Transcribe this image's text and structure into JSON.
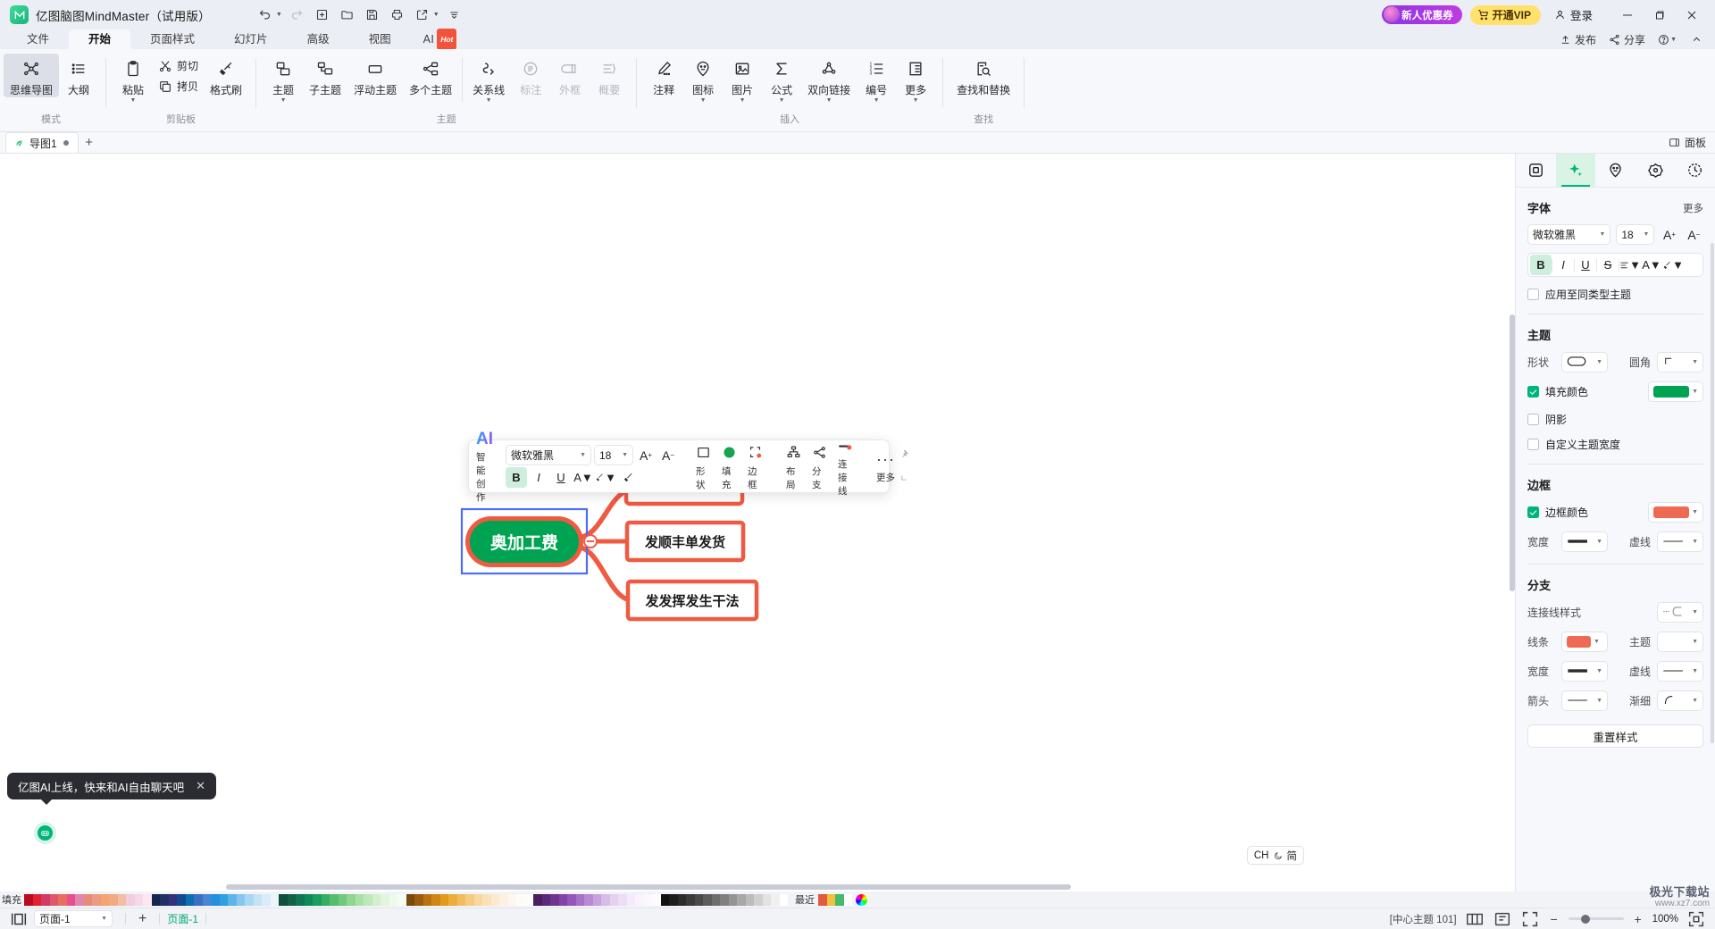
{
  "titlebar": {
    "app_title": "亿图脑图MindMaster（试用版）",
    "logo_icon": "mindmaster-logo-icon",
    "tools": [
      {
        "name": "undo-button",
        "icon": "undo-icon",
        "caret": true
      },
      {
        "name": "redo-button",
        "icon": "redo-icon",
        "caret": false
      },
      {
        "name": "new-button",
        "icon": "plus-square-icon",
        "caret": false
      },
      {
        "name": "open-button",
        "icon": "folder-icon",
        "caret": false
      },
      {
        "name": "save-button",
        "icon": "save-icon",
        "caret": false
      },
      {
        "name": "print-button",
        "icon": "printer-icon",
        "caret": false
      },
      {
        "name": "share-export-button",
        "icon": "share-box-icon",
        "caret": true
      },
      {
        "name": "more-toolbar-button",
        "icon": "more-bars-icon",
        "caret": false
      }
    ],
    "coupon_label": "新人优惠券",
    "vip_label": "开通VIP",
    "login_label": "登录",
    "window_buttons": [
      "minimize",
      "maximize",
      "close"
    ]
  },
  "ribbon_tabs": {
    "items": [
      {
        "label": "文件",
        "name": "tab-file",
        "active": false
      },
      {
        "label": "开始",
        "name": "tab-home",
        "active": true
      },
      {
        "label": "页面样式",
        "name": "tab-page-style",
        "active": false
      },
      {
        "label": "幻灯片",
        "name": "tab-slides",
        "active": false
      },
      {
        "label": "高级",
        "name": "tab-advanced",
        "active": false
      },
      {
        "label": "视图",
        "name": "tab-view",
        "active": false
      }
    ],
    "ai_label": "AI",
    "ai_badge": "Hot",
    "right_items": [
      {
        "label": "发布",
        "name": "publish-button",
        "icon": "upload-icon"
      },
      {
        "label": "分享",
        "name": "share-button",
        "icon": "share-icon"
      },
      {
        "label": "",
        "name": "help-button",
        "icon": "question-icon"
      },
      {
        "label": "",
        "name": "collapse-ribbon-button",
        "icon": "chevron-up-icon"
      }
    ]
  },
  "ribbon": {
    "groups": [
      {
        "label": "模式",
        "name": "group-mode",
        "items": [
          {
            "label": "思维导图",
            "name": "mindmap-mode-button",
            "icon": "mindmap-icon",
            "selected": true,
            "dropdown": false,
            "disabled": false
          },
          {
            "label": "大纲",
            "name": "outline-mode-button",
            "icon": "outline-icon",
            "selected": false,
            "dropdown": false,
            "disabled": false
          }
        ]
      },
      {
        "label": "剪贴板",
        "name": "group-clipboard",
        "items": [
          {
            "label": "粘贴",
            "name": "paste-button",
            "icon": "clipboard-icon",
            "selected": false,
            "dropdown": true,
            "disabled": false
          },
          {
            "label": "剪切",
            "name": "cut-button",
            "icon": "scissors-icon",
            "horizontal": true
          },
          {
            "label": "拷贝",
            "name": "copy-button",
            "icon": "copy-icon",
            "horizontal": true
          },
          {
            "label": "格式刷",
            "name": "format-painter-button",
            "icon": "brush-icon",
            "selected": false,
            "dropdown": false,
            "disabled": false
          }
        ]
      },
      {
        "label": "主题",
        "name": "group-topic",
        "items": [
          {
            "label": "主题",
            "name": "topic-button",
            "icon": "topic-icon",
            "selected": false,
            "dropdown": true,
            "disabled": false
          },
          {
            "label": "子主题",
            "name": "subtopic-button",
            "icon": "subtopic-icon",
            "selected": false,
            "dropdown": false,
            "disabled": false
          },
          {
            "label": "浮动主题",
            "name": "floating-topic-button",
            "icon": "floating-topic-icon",
            "selected": false,
            "dropdown": false,
            "disabled": false
          },
          {
            "label": "多个主题",
            "name": "multi-topic-button",
            "icon": "multi-topic-icon",
            "selected": false,
            "dropdown": false,
            "disabled": false
          },
          {
            "label": "关系线",
            "name": "relationship-line-button",
            "icon": "relationship-icon",
            "selected": false,
            "dropdown": true,
            "disabled": false
          },
          {
            "label": "标注",
            "name": "callout-button",
            "icon": "callout-icon",
            "selected": false,
            "dropdown": false,
            "disabled": true
          },
          {
            "label": "外框",
            "name": "boundary-button",
            "icon": "boundary-icon",
            "selected": false,
            "dropdown": false,
            "disabled": true
          },
          {
            "label": "概要",
            "name": "summary-button",
            "icon": "summary-icon",
            "selected": false,
            "dropdown": false,
            "disabled": true
          }
        ]
      },
      {
        "label": "插入",
        "name": "group-insert",
        "items": [
          {
            "label": "注释",
            "name": "comment-button",
            "icon": "pencil-note-icon",
            "selected": false,
            "dropdown": false,
            "disabled": false
          },
          {
            "label": "图标",
            "name": "icon-button",
            "icon": "emoji-pin-icon",
            "selected": false,
            "dropdown": true,
            "disabled": false
          },
          {
            "label": "图片",
            "name": "image-button",
            "icon": "image-icon",
            "selected": false,
            "dropdown": true,
            "disabled": false
          },
          {
            "label": "公式",
            "name": "formula-button",
            "icon": "sigma-icon",
            "selected": false,
            "dropdown": true,
            "disabled": false
          },
          {
            "label": "双向链接",
            "name": "bidirectional-link-button",
            "icon": "link-node-icon",
            "selected": false,
            "dropdown": true,
            "disabled": false
          },
          {
            "label": "编号",
            "name": "numbering-button",
            "icon": "numbered-list-icon",
            "selected": false,
            "dropdown": true,
            "disabled": false
          },
          {
            "label": "更多",
            "name": "insert-more-button",
            "icon": "more-panel-icon",
            "selected": false,
            "dropdown": true,
            "disabled": false
          }
        ]
      },
      {
        "label": "查找",
        "name": "group-find",
        "items": [
          {
            "label": "查找和替换",
            "name": "find-replace-button",
            "icon": "find-replace-icon",
            "selected": false,
            "dropdown": false,
            "disabled": false
          }
        ]
      }
    ]
  },
  "doctabs": {
    "tabs": [
      {
        "label": "导图1",
        "name": "document-tab-1",
        "modified": true
      }
    ],
    "add_label": "+",
    "panel_toggle_label": "面板",
    "panel_toggle_icon": "panel-icon"
  },
  "floating_toolbar": {
    "ai_title": "AI",
    "ai_sub": "智能创作",
    "font_family": "微软雅黑",
    "font_size": "18",
    "increase_font_icon": "increase-font-icon",
    "decrease_font_icon": "decrease-font-icon",
    "bold": "B",
    "italic": "I",
    "underline": "U",
    "font_color_icon": "font-color-icon",
    "highlight_icon": "highlight-icon",
    "format_painter_icon": "format-painter-icon",
    "groups": [
      {
        "label": "形状",
        "name": "shape-button",
        "icon": "square-shape-icon"
      },
      {
        "label": "填充",
        "name": "fill-button",
        "icon": "fill-circle-icon",
        "color": "#14a44d"
      },
      {
        "label": "边框",
        "name": "border-button",
        "icon": "border-icon",
        "color": "#ef5a41"
      },
      {
        "label": "布局",
        "name": "layout-button",
        "icon": "layout-icon"
      },
      {
        "label": "分支",
        "name": "branch-button",
        "icon": "branch-icon"
      },
      {
        "label": "连接线",
        "name": "connector-button",
        "icon": "connector-icon",
        "color": "#ef5a41"
      },
      {
        "label": "更多",
        "name": "more-button",
        "icon": "ellipsis-icon"
      }
    ],
    "pin_icon": "pin-icon",
    "resize_icon": "resize-handle-icon"
  },
  "mindmap": {
    "central_topic": {
      "text": "奥加工费",
      "name": "central-topic-node",
      "fill": "#00a352",
      "border": "#ef5a41",
      "selection": "#4a6cf7"
    },
    "branches": [
      {
        "text": "发顺丰单发货",
        "name": "topic-node-2"
      },
      {
        "text": "发发挥发生干法",
        "name": "topic-node-3"
      }
    ],
    "collapse_icon": "collapse-minus-icon",
    "node_border_color": "#ef5a41"
  },
  "right_panel": {
    "tabs": [
      {
        "name": "panel-tab-style",
        "icon": "style-square-icon",
        "active": false
      },
      {
        "name": "panel-tab-ai",
        "icon": "ai-sparkle-icon",
        "active": true
      },
      {
        "name": "panel-tab-icon",
        "icon": "emoji-pin-icon",
        "active": false
      },
      {
        "name": "panel-tab-sticker",
        "icon": "sticker-flower-icon",
        "active": false
      },
      {
        "name": "panel-tab-history",
        "icon": "history-clock-icon",
        "active": false
      }
    ],
    "font_section": {
      "title": "字体",
      "more": "更多",
      "family": "微软雅黑",
      "size": "18",
      "increase_icon": "increase-font-icon",
      "decrease_icon": "decrease-font-icon",
      "bold": "B",
      "italic": "I",
      "underline": "U",
      "strikethrough": "S",
      "align_icon": "align-icon",
      "font_color_icon": "font-color-icon",
      "highlight_icon": "highlight-icon",
      "apply_same_label": "应用至同类型主题",
      "apply_same_checked": false
    },
    "topic_section": {
      "title": "主题",
      "shape_label": "形状",
      "shape_value_icon": "rounded-rect-icon",
      "corner_label": "圆角",
      "corner_value_icon": "corner-icon",
      "fill_label": "填充颜色",
      "fill_checked": true,
      "fill_color": "#00a352",
      "shadow_label": "阴影",
      "shadow_checked": false,
      "custom_width_label": "自定义主题宽度",
      "custom_width_checked": false
    },
    "border_section": {
      "title": "边框",
      "color_label": "边框颜色",
      "color_checked": true,
      "color": "#ef6a52",
      "width_label": "宽度",
      "dash_label": "虚线"
    },
    "branch_section": {
      "title": "分支",
      "style_label": "连接线样式",
      "line_label": "线条",
      "line_color": "#ef6a52",
      "topic_label": "主题",
      "width_label": "宽度",
      "dash_label": "虚线",
      "arrow_label": "箭头",
      "taper_label": "渐细"
    },
    "reset_label": "重置样式"
  },
  "ai_tip": {
    "text": "亿图AI上线，快来和AI自由聊天吧",
    "close_icon": "close-icon",
    "bot_icon": "robot-icon"
  },
  "lang_pill": {
    "label": "CH",
    "mode": "简",
    "moon_icon": "moon-icon"
  },
  "color_strip": {
    "fill_label": "填充",
    "recent_label": "最近",
    "colors": [
      "#b60d1f",
      "#e02230",
      "#cf3a68",
      "#e0566a",
      "#e5705f",
      "#e84f8d",
      "#e087ad",
      "#e88a7a",
      "#ec9a84",
      "#f3a46f",
      "#eeab84",
      "#f3bfa3",
      "#f0cde0",
      "#f7d8e8",
      "#fbe9f2",
      "#16254f",
      "#1d3164",
      "#35307a",
      "#12498f",
      "#0c6fb0",
      "#3b6fc4",
      "#4b86d1",
      "#2490dc",
      "#2ea0e0",
      "#5eb4e8",
      "#86c6ee",
      "#a9d6f2",
      "#c5e3f6",
      "#d9edf9",
      "#eaf5fc",
      "#0f4d3c",
      "#136048",
      "#0e7650",
      "#0f8a56",
      "#1a9e5f",
      "#36ae63",
      "#56bd6f",
      "#6ec87d",
      "#8ed692",
      "#a9e0a5",
      "#bfe8b9",
      "#d3efcd",
      "#e2f5dd",
      "#eefaea",
      "#f5fdf3",
      "#7a4a0c",
      "#9a5c0e",
      "#b87212",
      "#d08617",
      "#e2991c",
      "#ecae3a",
      "#f0bd5d",
      "#f4cb81",
      "#f7d89f",
      "#f9e2b8",
      "#fbead0",
      "#fdf2e2",
      "#fef7ee",
      "#fffbf6",
      "#fffdfa",
      "#4a1e60",
      "#5c2878",
      "#6f3490",
      "#8244a6",
      "#9459b8",
      "#a671c6",
      "#b78ad2",
      "#c7a3dd",
      "#d6bce7",
      "#e3d1ef",
      "#ecdff5",
      "#f3ebf9",
      "#f8f3fc",
      "#fbf8fd",
      "#fdfbfe",
      "#111111",
      "#1d1d1d",
      "#2b2b2b",
      "#3a3a3a",
      "#4a4a4a",
      "#5c5c5c",
      "#6e6e6e",
      "#808080",
      "#949494",
      "#a8a8a8",
      "#bcbcbc",
      "#d0d0d0",
      "#e2e2e2",
      "#f0f0f0",
      "#ffffff"
    ],
    "recent_colors": [
      "#e05a3d",
      "#f0c040",
      "#46b96a",
      "#ffffff"
    ]
  },
  "statusbar": {
    "view_icon": "fit-view-icon",
    "page_value": "页面-1",
    "add_page_label": "+",
    "current_page": "页面-1",
    "center_info": "[中心主题 101]",
    "right_icons": [
      "grid-view-icon",
      "fit-page-icon",
      "fullscreen-icon"
    ],
    "zoom_minus": "−",
    "zoom_plus": "+",
    "zoom_value": "100%",
    "zoom_reset_icon": "zoom-reset-icon"
  },
  "watermark": {
    "line1": "极光下载站",
    "line2": "www.xz7.com"
  }
}
